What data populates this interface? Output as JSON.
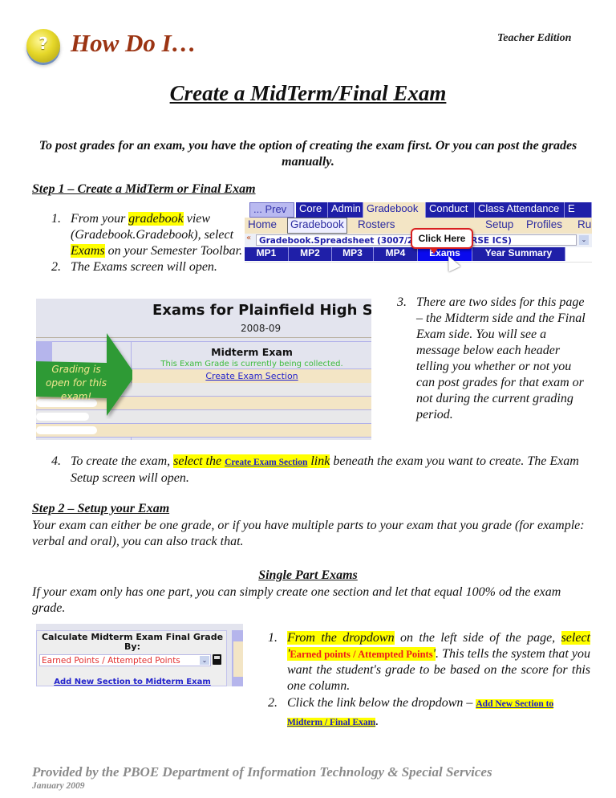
{
  "header": {
    "logo_icon": "question-mark-button-icon",
    "logo_glyph": "?",
    "how_do_i": "How Do I…",
    "edition": "Teacher Edition"
  },
  "title": "Create a MidTerm/Final Exam",
  "intro": "To post grades for an exam, you have the option of creating the exam first. Or you can post the grades manually.",
  "step1": {
    "heading": "Step 1 – Create a MidTerm or Final Exam",
    "item1": {
      "num": "1.",
      "pre": "From your ",
      "hl1": "gradebook",
      "mid1": " view (Gradebook.Gradebook), select ",
      "hl2": "Exams",
      "post": " on your Semester Toolbar."
    },
    "item2": {
      "num": "2.",
      "text": "The Exams screen will open."
    },
    "item3": {
      "num": "3.",
      "text": "There are two sides for this page – the Midterm side and the Final Exam side. You will see a message below each header telling you whether or not you can post grades for that exam or not during the current grading period."
    },
    "item4": {
      "num": "4.",
      "pre": "To create the exam, ",
      "hl_pre": "select the ",
      "link": "Create Exam Section",
      "hl_post": " link",
      "post": " beneath the exam you want to create. The Exam Setup screen will open."
    }
  },
  "toolbar_shot": {
    "top_tabs": [
      "... Prev",
      "Core",
      "Admin",
      "Gradebook",
      "Conduct",
      "Class Attendance",
      "E"
    ],
    "active_top_tab": "Gradebook",
    "sub_tabs": [
      "Home",
      "Gradebook",
      "Rosters",
      "Setup",
      "Profiles",
      "Rub"
    ],
    "active_sub_tab": "Gradebook",
    "breadcrumb_arrow": "«",
    "select_value": "Gradebook.Spreadsheet (3007/2 ... RED COURSE ICS)",
    "semester_tabs": [
      "MP1",
      "MP2",
      "MP3",
      "MP4",
      "Exams",
      "Year Summary"
    ],
    "selected_semester_tab": "Exams",
    "callout": "Click Here"
  },
  "exams_shot": {
    "title": "Exams for Plainfield High Sch",
    "year": "2008-09",
    "arrow_text": "Grading is open for this exam!",
    "midterm_title": "Midterm Exam",
    "midterm_status": "This Exam Grade is currently being collected.",
    "create_link": "Create Exam Section",
    "colors": {
      "arrow": "#2e9a35",
      "status": "#3dbb3d",
      "link": "#2323cc"
    }
  },
  "step2": {
    "heading": "Step 2 – Setup your Exam",
    "text": "Your exam can either be one grade, or if you have multiple parts to your exam that you grade (for example: verbal and oral), you can also track that.",
    "single_heading": "Single Part Exams",
    "single_text": "If your exam only has one part, you can simply create one section and let that equal 100% od the exam grade.",
    "item1": {
      "num": "1.",
      "hl1": "From the dropdown",
      "mid": " on the left side of the page, ",
      "hl2_pre": "select '",
      "value": "Earned points / Attempted Points",
      "hl2_post": "'",
      "post": ". This tells the system that you want the student's grade to be based on the score for this one column."
    },
    "item2": {
      "num": "2.",
      "pre": "Click the link below the dropdown – ",
      "link": "Add New Section to Midterm / Final Exam",
      "post": "."
    }
  },
  "calc_shot": {
    "title": "Calculate Midterm Exam Final Grade By:",
    "select_value": "Earned Points / Attempted Points",
    "save_icon": "floppy-disk-icon",
    "link": "Add New Section to Midterm Exam"
  },
  "footer": {
    "line1": "Provided by the PBOE Department of Information Technology & Special Services",
    "line2": "January 2009"
  }
}
